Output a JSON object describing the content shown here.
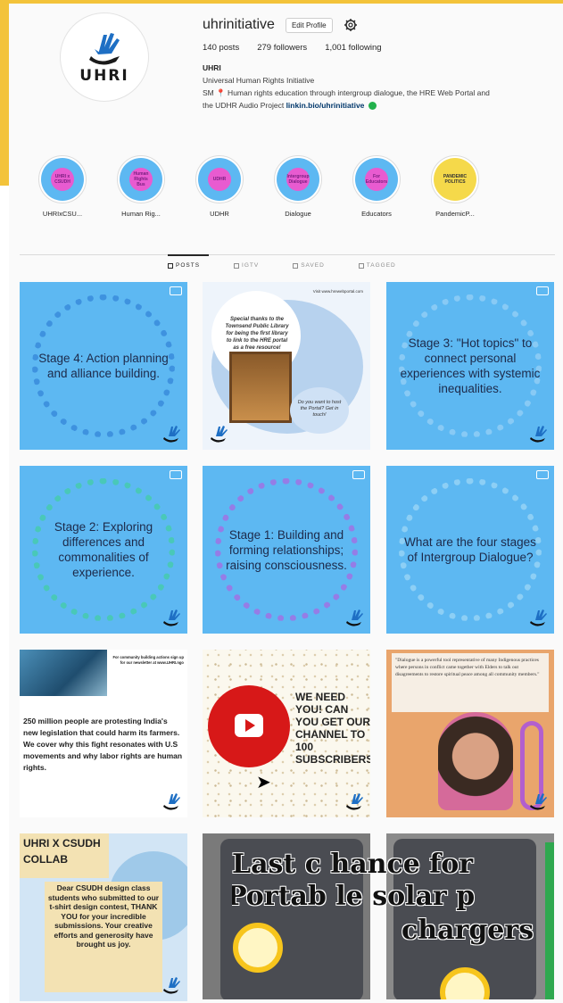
{
  "profile": {
    "username": "uhrinitiative",
    "edit_label": "Edit Profile",
    "stats": {
      "posts": "140 posts",
      "followers": "279 followers",
      "following": "1,001 following"
    },
    "bio_name": "UHRI",
    "bio_line1": "Universal Human Rights Initiative",
    "bio_line2": "SM 📍 Human rights education through intergroup dialogue, the HRE Web Portal and",
    "bio_line3": "the UDHR Audio Project",
    "bio_link": "linkin.bio/uhrinitiative",
    "logo_text": "UHRI"
  },
  "highlights": [
    {
      "label": "UHRIxCSU...",
      "ring_color": "#5db8f2",
      "dot_color": "#e85bd0",
      "dot_text": "UHRI x CSUDH"
    },
    {
      "label": "Human Rig...",
      "ring_color": "#5db8f2",
      "dot_color": "#e85bd0",
      "dot_text": "Human Rights Bus"
    },
    {
      "label": "UDHR",
      "ring_color": "#5db8f2",
      "dot_color": "#e85bd0",
      "dot_text": "UDHR"
    },
    {
      "label": "Dialogue",
      "ring_color": "#5db8f2",
      "dot_color": "#e85bd0",
      "dot_text": "Intergroup Dialogue"
    },
    {
      "label": "Educators",
      "ring_color": "#5db8f2",
      "dot_color": "#e85bd0",
      "dot_text": "For Educators"
    },
    {
      "label": "PandemicP...",
      "ring_color": "#f5d94a",
      "dot_color": "#f5d94a",
      "dot_text": "PANDEMIC POLITICS"
    }
  ],
  "tabs": [
    {
      "label": "POSTS",
      "active": true
    },
    {
      "label": "IGTV",
      "active": false
    },
    {
      "label": "SAVED",
      "active": false
    },
    {
      "label": "TAGGED",
      "active": false
    }
  ],
  "posts": {
    "p1": "Stage 4: Action planning and alliance building.",
    "p2_url": "Visit www.hrewebportal.com",
    "p2_circle": "Special thanks to the Townsend Public Library for being the first library to link to the HRE portal as a free resource!",
    "p2_bubble": "Do you want to host the Portal? Get in touch!",
    "p3": "Stage 3: \"Hot topics\" to connect personal experiences with systemic inequalities.",
    "p4": "Stage 2: Exploring differences and commonalities of experience.",
    "p5": "Stage 1: Building and forming relationships; raising consciousness.",
    "p6": "What are the four stages of Intergroup Dialogue?",
    "p7_caption": "For community building actions sign up for our newsletter at www.UHRI.ngo",
    "p7_body": "250 million people are protesting India's new legislation that could harm its farmers. We cover why this fight resonates with U.S movements and why labor rights are human rights.",
    "p8": "WE NEED YOU! CAN YOU GET OUR CHANNEL TO 100 SUBSCRIBERS?",
    "p9": "\"Dialogue is a powerful tool representative of many Indigenous practices where persons in conflict came together with Elders to talk out disagreements to restore spiritual peace among all community members.\"",
    "p10_title": "UHRI X CSUDH COLLAB",
    "p10_body": "Dear CSUDH design class students who submitted to our t-shirt design contest, THANK YOU for your incredible submissions. Your creative efforts and generosity have brought us joy.",
    "banner_l1": "Last c hance for",
    "banner_l2": "Portab le solar p",
    "banner_l3": "chargers"
  },
  "colors": {
    "stage_bg": "#5db8f2",
    "accent_yellow": "#f3c33a",
    "verified": "#22b14c"
  },
  "icons": [
    "gear-icon",
    "verified-icon",
    "video-icon",
    "uhri-hand-logo",
    "youtube-icon",
    "cursor-icon",
    "sun-icon"
  ]
}
